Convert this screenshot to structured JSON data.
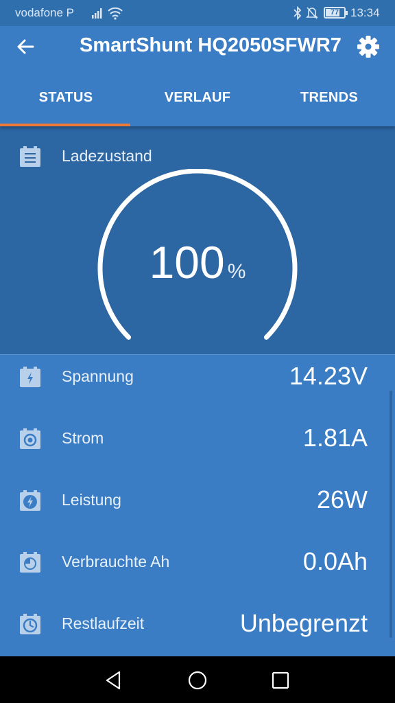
{
  "status_bar": {
    "carrier": "vodafone P",
    "battery": "77",
    "battery_level": 0.77,
    "time": "13:34"
  },
  "app_bar": {
    "title": "SmartShunt HQ2050SFWR7",
    "back_icon": "arrow-left-icon",
    "settings_icon": "gear-icon"
  },
  "tabs": [
    {
      "label": "STATUS",
      "active": true
    },
    {
      "label": "VERLAUF",
      "active": false
    },
    {
      "label": "TRENDS",
      "active": false
    }
  ],
  "gauge": {
    "title": "Ladezustand",
    "value": "100",
    "unit": "%",
    "level": 1.0
  },
  "readings": [
    {
      "label": "Spannung",
      "value": "14.23V",
      "icon": "voltage-battery-icon"
    },
    {
      "label": "Strom",
      "value": "1.81A",
      "icon": "current-battery-icon"
    },
    {
      "label": "Leistung",
      "value": "26W",
      "icon": "power-battery-icon"
    },
    {
      "label": "Verbrauchte Ah",
      "value": "0.0Ah",
      "icon": "consumed-battery-icon"
    },
    {
      "label": "Restlaufzeit",
      "value": "Unbegrenzt",
      "icon": "time-battery-icon"
    }
  ],
  "colors": {
    "header": "#3a7dc5",
    "gauge_background": "#2c66a3",
    "tab_indicator": "#f07a35",
    "icon_fill": "#b8d0ea"
  }
}
